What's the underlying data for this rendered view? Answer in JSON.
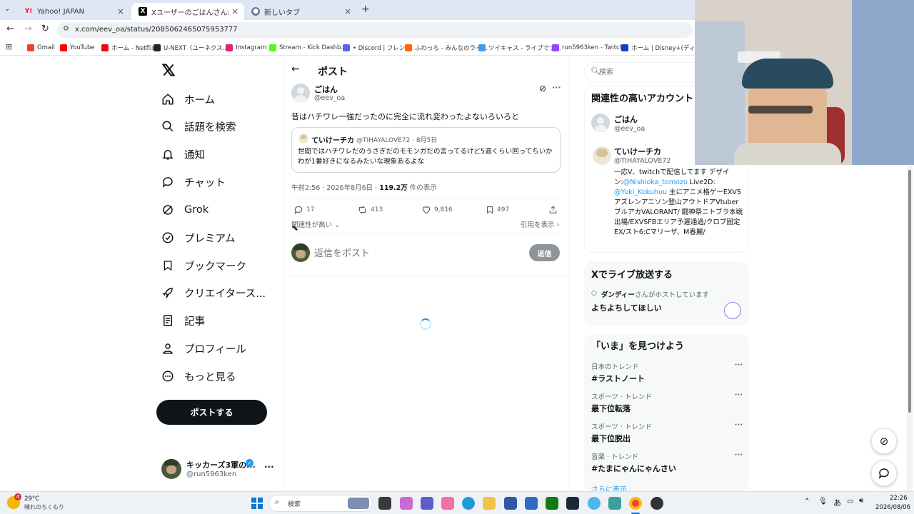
{
  "browser": {
    "tabs": [
      {
        "title": "Yahoo! JAPAN",
        "icon": "yahoo-icon"
      },
      {
        "title": "Xユーザーのごはんさん:「昔はハチワレ...",
        "icon": "x-icon",
        "active": true
      },
      {
        "title": "新しいタブ",
        "icon": "chrome-icon"
      }
    ],
    "url": "x.com/eev_oa/status/2085062465075953777",
    "bookmarks": [
      {
        "label": "Gmail",
        "color": "#ea4335"
      },
      {
        "label": "YouTube",
        "color": "#ff0000"
      },
      {
        "label": "ホーム - Netflix",
        "color": "#e50914"
      },
      {
        "label": "U-NEXT〈ユーネクス...",
        "color": "#222222"
      },
      {
        "label": "Instagram",
        "color": "#d62976"
      },
      {
        "label": "Stream - Kick Dashb...",
        "color": "#53fc18"
      },
      {
        "label": "• Discord | フレンド",
        "color": "#5865f2"
      },
      {
        "label": "ふわっち - みんなのライ...",
        "color": "#ff6600"
      },
      {
        "label": "ツイキャス - ライブでつ...",
        "color": "#3b9cf0"
      },
      {
        "label": "run5963ken - Twitch",
        "color": "#9146ff"
      },
      {
        "label": "ホーム | Disney+(ディ...",
        "color": "#113ccf"
      }
    ]
  },
  "nav": {
    "items": [
      {
        "label": "ホーム",
        "icon": "home-icon"
      },
      {
        "label": "話題を検索",
        "icon": "search-icon"
      },
      {
        "label": "通知",
        "icon": "bell-icon"
      },
      {
        "label": "チャット",
        "icon": "chat-icon"
      },
      {
        "label": "Grok",
        "icon": "grok-icon"
      },
      {
        "label": "プレミアム",
        "icon": "verified-icon"
      },
      {
        "label": "ブックマーク",
        "icon": "bookmark-icon"
      },
      {
        "label": "クリエイタース...",
        "icon": "rocket-icon"
      },
      {
        "label": "記事",
        "icon": "article-icon"
      },
      {
        "label": "プロフィール",
        "icon": "profile-icon"
      },
      {
        "label": "もっと見る",
        "icon": "more-icon"
      }
    ],
    "post_button": "ポストする",
    "account": {
      "name": "キッカーズ3軍の...",
      "handle": "@run5963ken"
    }
  },
  "main": {
    "header": "ポスト",
    "post": {
      "name": "ごはん",
      "handle": "@eev_oa",
      "text": "昔はハチワレ一強だったのに完全に流れ変わったよないろいろと",
      "quote": {
        "name": "ていけーチカ",
        "handle_date": "@TIHAYALOVE72 · 8月5日",
        "text": "世間ではハチワレだのうさぎだのモモンガだの言ってるけど5週くらい回ってちいかわが1番好きになるみたいな現象あるよな"
      },
      "time": "午前2:56 · 2026年8月6日 · ",
      "views_count": "119.2万",
      "views_label": " 件の表示",
      "replies": "17",
      "reposts": "413",
      "likes": "9,816",
      "bookmarks": "497"
    },
    "sort_label": "関連性が高い",
    "quotes_link": "引用を表示",
    "reply_placeholder": "返信をポスト",
    "reply_button": "返信"
  },
  "right": {
    "search_placeholder": "検索",
    "related_title": "関連性の高いアカウント",
    "accounts": [
      {
        "name": "ごはん",
        "handle": "@eev_oa"
      },
      {
        "name": "ていけーチカ",
        "handle": "@TIHAYALOVE72"
      }
    ],
    "bio_prefix": "一応V、twitchで配信してます デザイン:",
    "bio_link1": "@Nishioka_tomozo",
    "bio_mid": " Live2D:",
    "bio_link2": "@Yuki_Kokuhuu",
    "bio_rest": " 主にアニメ格ゲーEXVSアズレンアニソン登山アウトドアVtuberブルアカVALORANT/ 闘神祭ニトブラ本戦出場/EXVSFBエリア予選通過/クロブ固定EX/スト6:Cマリーザ、M春麗/",
    "live_title": "Xでライブ放送する",
    "live_host_name": "ダンディー",
    "live_host_suffix": "さんがホストしています",
    "live_space": "よちよちしてほしい",
    "trends_title": "「いま」を見つけよう",
    "trends": [
      {
        "category": "日本のトレンド",
        "name": "#ラストノート"
      },
      {
        "category": "スポーツ · トレンド",
        "name": "最下位転落"
      },
      {
        "category": "スポーツ · トレンド",
        "name": "最下位脱出"
      },
      {
        "category": "音楽 · トレンド",
        "name": "#たまにゃんにゃんさい"
      }
    ],
    "show_more": "さらに表示"
  },
  "taskbar": {
    "weather_temp": "29°C",
    "weather_desc": "晴れのちくもり",
    "weather_badge": "4",
    "search_label": "検索",
    "ime": "あ",
    "time": "22:26",
    "date": "2026/08/06"
  },
  "colors": {
    "accent": "#1d9bf0",
    "black": "#0f1419",
    "muted": "#536471"
  }
}
